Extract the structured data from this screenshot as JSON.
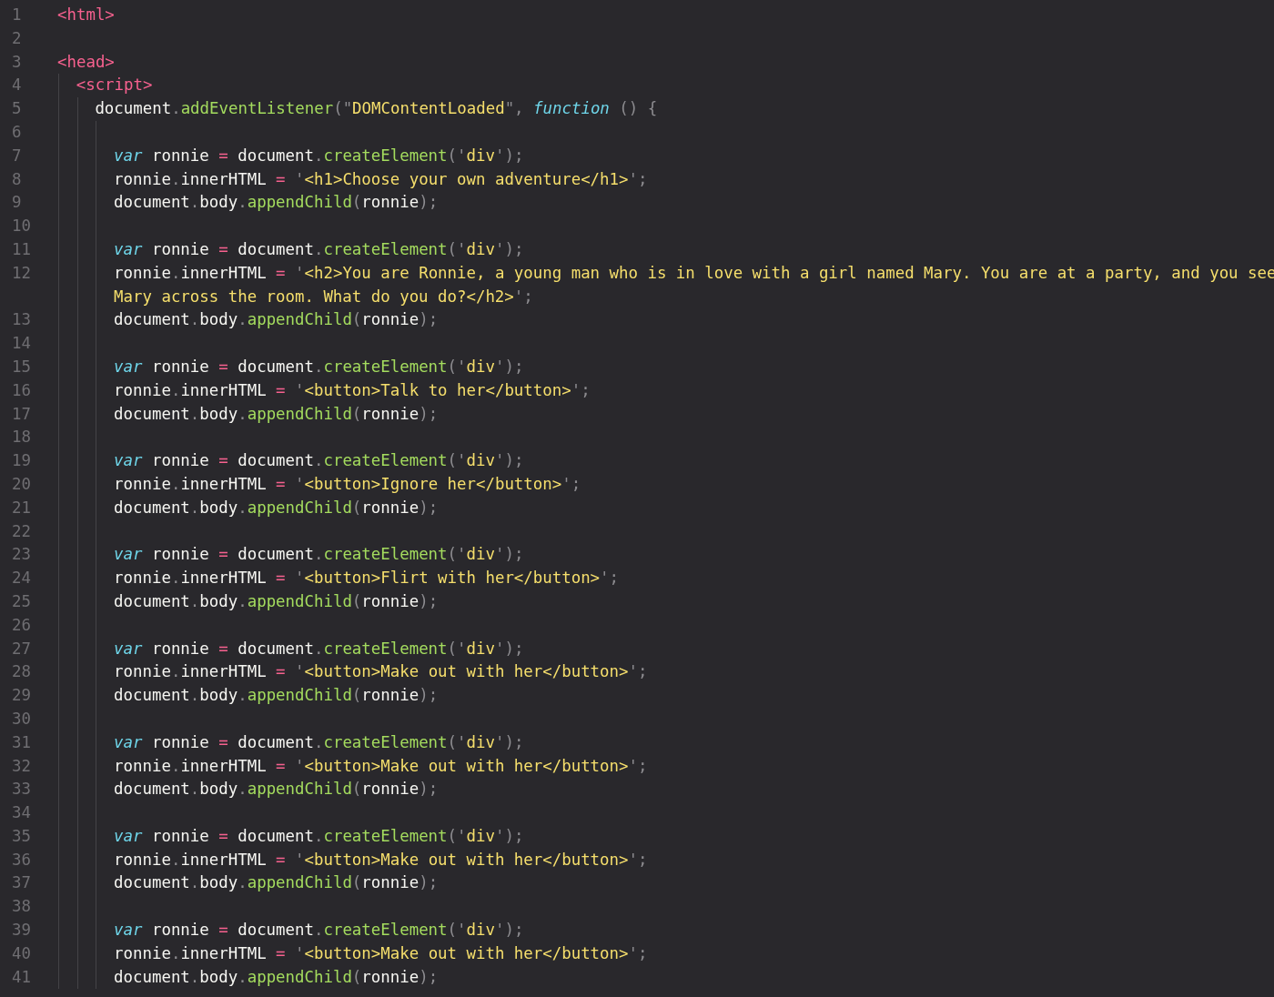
{
  "editor": {
    "lines": [
      {
        "number": "1",
        "tokens": [
          {
            "kind": "tag",
            "text": "<html>"
          }
        ]
      },
      {
        "number": "2"
      },
      {
        "number": "3",
        "tokens": [
          {
            "kind": "tag",
            "text": "<head>"
          }
        ],
        "children": [
          {
            "number": "4",
            "tokens": [
              {
                "kind": "tag",
                "text": "<script>"
              }
            ],
            "children": [
              {
                "number": "5",
                "tokens": [
                  {
                    "kind": "plain",
                    "text": "document"
                  },
                  {
                    "kind": "punct",
                    "text": "."
                  },
                  {
                    "kind": "method",
                    "text": "addEventListener"
                  },
                  {
                    "kind": "punct",
                    "text": "(\""
                  },
                  {
                    "kind": "string",
                    "text": "DOMContentLoaded"
                  },
                  {
                    "kind": "punct",
                    "text": "\", "
                  },
                  {
                    "kind": "keyword",
                    "text": "function"
                  },
                  {
                    "kind": "punct",
                    "text": " () {"
                  }
                ],
                "children": [
                  {
                    "number": "6"
                  },
                  {
                    "number": "7",
                    "tokens": [
                      {
                        "kind": "keyword",
                        "text": "var"
                      },
                      {
                        "kind": "plain",
                        "text": " ronnie "
                      },
                      {
                        "kind": "operator",
                        "text": "="
                      },
                      {
                        "kind": "plain",
                        "text": " document"
                      },
                      {
                        "kind": "punct",
                        "text": "."
                      },
                      {
                        "kind": "method",
                        "text": "createElement"
                      },
                      {
                        "kind": "punct",
                        "text": "('"
                      },
                      {
                        "kind": "string",
                        "text": "div"
                      },
                      {
                        "kind": "punct",
                        "text": "');"
                      }
                    ]
                  },
                  {
                    "number": "8",
                    "tokens": [
                      {
                        "kind": "plain",
                        "text": "ronnie"
                      },
                      {
                        "kind": "punct",
                        "text": "."
                      },
                      {
                        "kind": "plain",
                        "text": "innerHTML "
                      },
                      {
                        "kind": "operator",
                        "text": "="
                      },
                      {
                        "kind": "punct",
                        "text": " '"
                      },
                      {
                        "kind": "string",
                        "text": "<h1>Choose your own adventure</h1>"
                      },
                      {
                        "kind": "punct",
                        "text": "';"
                      }
                    ]
                  },
                  {
                    "number": "9",
                    "tokens": [
                      {
                        "kind": "plain",
                        "text": "document"
                      },
                      {
                        "kind": "punct",
                        "text": "."
                      },
                      {
                        "kind": "plain",
                        "text": "body"
                      },
                      {
                        "kind": "punct",
                        "text": "."
                      },
                      {
                        "kind": "method",
                        "text": "appendChild"
                      },
                      {
                        "kind": "punct",
                        "text": "("
                      },
                      {
                        "kind": "plain",
                        "text": "ronnie"
                      },
                      {
                        "kind": "punct",
                        "text": ");"
                      }
                    ]
                  },
                  {
                    "number": "10"
                  },
                  {
                    "number": "11",
                    "tokens": [
                      {
                        "kind": "keyword",
                        "text": "var"
                      },
                      {
                        "kind": "plain",
                        "text": " ronnie "
                      },
                      {
                        "kind": "operator",
                        "text": "="
                      },
                      {
                        "kind": "plain",
                        "text": " document"
                      },
                      {
                        "kind": "punct",
                        "text": "."
                      },
                      {
                        "kind": "method",
                        "text": "createElement"
                      },
                      {
                        "kind": "punct",
                        "text": "('"
                      },
                      {
                        "kind": "string",
                        "text": "div"
                      },
                      {
                        "kind": "punct",
                        "text": "');"
                      }
                    ]
                  },
                  {
                    "number": "12",
                    "tokens": [
                      {
                        "kind": "plain",
                        "text": "ronnie"
                      },
                      {
                        "kind": "punct",
                        "text": "."
                      },
                      {
                        "kind": "plain",
                        "text": "innerHTML "
                      },
                      {
                        "kind": "operator",
                        "text": "="
                      },
                      {
                        "kind": "punct",
                        "text": " '"
                      },
                      {
                        "kind": "string",
                        "text": "<h2>You are Ronnie, a young man who is in love with a girl named Mary. You are at a party, and you see"
                      }
                    ],
                    "wrap": [
                      {
                        "kind": "string",
                        "text": "Mary across the room. What do you do?</h2>"
                      },
                      {
                        "kind": "punct",
                        "text": "';"
                      }
                    ]
                  },
                  {
                    "number": "13",
                    "tokens": [
                      {
                        "kind": "plain",
                        "text": "document"
                      },
                      {
                        "kind": "punct",
                        "text": "."
                      },
                      {
                        "kind": "plain",
                        "text": "body"
                      },
                      {
                        "kind": "punct",
                        "text": "."
                      },
                      {
                        "kind": "method",
                        "text": "appendChild"
                      },
                      {
                        "kind": "punct",
                        "text": "("
                      },
                      {
                        "kind": "plain",
                        "text": "ronnie"
                      },
                      {
                        "kind": "punct",
                        "text": ");"
                      }
                    ]
                  },
                  {
                    "number": "14"
                  },
                  {
                    "number": "15",
                    "tokens": [
                      {
                        "kind": "keyword",
                        "text": "var"
                      },
                      {
                        "kind": "plain",
                        "text": " ronnie "
                      },
                      {
                        "kind": "operator",
                        "text": "="
                      },
                      {
                        "kind": "plain",
                        "text": " document"
                      },
                      {
                        "kind": "punct",
                        "text": "."
                      },
                      {
                        "kind": "method",
                        "text": "createElement"
                      },
                      {
                        "kind": "punct",
                        "text": "('"
                      },
                      {
                        "kind": "string",
                        "text": "div"
                      },
                      {
                        "kind": "punct",
                        "text": "');"
                      }
                    ]
                  },
                  {
                    "number": "16",
                    "tokens": [
                      {
                        "kind": "plain",
                        "text": "ronnie"
                      },
                      {
                        "kind": "punct",
                        "text": "."
                      },
                      {
                        "kind": "plain",
                        "text": "innerHTML "
                      },
                      {
                        "kind": "operator",
                        "text": "="
                      },
                      {
                        "kind": "punct",
                        "text": " '"
                      },
                      {
                        "kind": "string",
                        "text": "<button>Talk to her</button>"
                      },
                      {
                        "kind": "punct",
                        "text": "';"
                      }
                    ]
                  },
                  {
                    "number": "17",
                    "tokens": [
                      {
                        "kind": "plain",
                        "text": "document"
                      },
                      {
                        "kind": "punct",
                        "text": "."
                      },
                      {
                        "kind": "plain",
                        "text": "body"
                      },
                      {
                        "kind": "punct",
                        "text": "."
                      },
                      {
                        "kind": "method",
                        "text": "appendChild"
                      },
                      {
                        "kind": "punct",
                        "text": "("
                      },
                      {
                        "kind": "plain",
                        "text": "ronnie"
                      },
                      {
                        "kind": "punct",
                        "text": ");"
                      }
                    ]
                  },
                  {
                    "number": "18"
                  },
                  {
                    "number": "19",
                    "tokens": [
                      {
                        "kind": "keyword",
                        "text": "var"
                      },
                      {
                        "kind": "plain",
                        "text": " ronnie "
                      },
                      {
                        "kind": "operator",
                        "text": "="
                      },
                      {
                        "kind": "plain",
                        "text": " document"
                      },
                      {
                        "kind": "punct",
                        "text": "."
                      },
                      {
                        "kind": "method",
                        "text": "createElement"
                      },
                      {
                        "kind": "punct",
                        "text": "('"
                      },
                      {
                        "kind": "string",
                        "text": "div"
                      },
                      {
                        "kind": "punct",
                        "text": "');"
                      }
                    ]
                  },
                  {
                    "number": "20",
                    "tokens": [
                      {
                        "kind": "plain",
                        "text": "ronnie"
                      },
                      {
                        "kind": "punct",
                        "text": "."
                      },
                      {
                        "kind": "plain",
                        "text": "innerHTML "
                      },
                      {
                        "kind": "operator",
                        "text": "="
                      },
                      {
                        "kind": "punct",
                        "text": " '"
                      },
                      {
                        "kind": "string",
                        "text": "<button>Ignore her</button>"
                      },
                      {
                        "kind": "punct",
                        "text": "';"
                      }
                    ]
                  },
                  {
                    "number": "21",
                    "tokens": [
                      {
                        "kind": "plain",
                        "text": "document"
                      },
                      {
                        "kind": "punct",
                        "text": "."
                      },
                      {
                        "kind": "plain",
                        "text": "body"
                      },
                      {
                        "kind": "punct",
                        "text": "."
                      },
                      {
                        "kind": "method",
                        "text": "appendChild"
                      },
                      {
                        "kind": "punct",
                        "text": "("
                      },
                      {
                        "kind": "plain",
                        "text": "ronnie"
                      },
                      {
                        "kind": "punct",
                        "text": ");"
                      }
                    ]
                  },
                  {
                    "number": "22"
                  },
                  {
                    "number": "23",
                    "tokens": [
                      {
                        "kind": "keyword",
                        "text": "var"
                      },
                      {
                        "kind": "plain",
                        "text": " ronnie "
                      },
                      {
                        "kind": "operator",
                        "text": "="
                      },
                      {
                        "kind": "plain",
                        "text": " document"
                      },
                      {
                        "kind": "punct",
                        "text": "."
                      },
                      {
                        "kind": "method",
                        "text": "createElement"
                      },
                      {
                        "kind": "punct",
                        "text": "('"
                      },
                      {
                        "kind": "string",
                        "text": "div"
                      },
                      {
                        "kind": "punct",
                        "text": "');"
                      }
                    ]
                  },
                  {
                    "number": "24",
                    "tokens": [
                      {
                        "kind": "plain",
                        "text": "ronnie"
                      },
                      {
                        "kind": "punct",
                        "text": "."
                      },
                      {
                        "kind": "plain",
                        "text": "innerHTML "
                      },
                      {
                        "kind": "operator",
                        "text": "="
                      },
                      {
                        "kind": "punct",
                        "text": " '"
                      },
                      {
                        "kind": "string",
                        "text": "<button>Flirt with her</button>"
                      },
                      {
                        "kind": "punct",
                        "text": "';"
                      }
                    ]
                  },
                  {
                    "number": "25",
                    "tokens": [
                      {
                        "kind": "plain",
                        "text": "document"
                      },
                      {
                        "kind": "punct",
                        "text": "."
                      },
                      {
                        "kind": "plain",
                        "text": "body"
                      },
                      {
                        "kind": "punct",
                        "text": "."
                      },
                      {
                        "kind": "method",
                        "text": "appendChild"
                      },
                      {
                        "kind": "punct",
                        "text": "("
                      },
                      {
                        "kind": "plain",
                        "text": "ronnie"
                      },
                      {
                        "kind": "punct",
                        "text": ");"
                      }
                    ]
                  },
                  {
                    "number": "26"
                  },
                  {
                    "number": "27",
                    "tokens": [
                      {
                        "kind": "keyword",
                        "text": "var"
                      },
                      {
                        "kind": "plain",
                        "text": " ronnie "
                      },
                      {
                        "kind": "operator",
                        "text": "="
                      },
                      {
                        "kind": "plain",
                        "text": " document"
                      },
                      {
                        "kind": "punct",
                        "text": "."
                      },
                      {
                        "kind": "method",
                        "text": "createElement"
                      },
                      {
                        "kind": "punct",
                        "text": "('"
                      },
                      {
                        "kind": "string",
                        "text": "div"
                      },
                      {
                        "kind": "punct",
                        "text": "');"
                      }
                    ]
                  },
                  {
                    "number": "28",
                    "tokens": [
                      {
                        "kind": "plain",
                        "text": "ronnie"
                      },
                      {
                        "kind": "punct",
                        "text": "."
                      },
                      {
                        "kind": "plain",
                        "text": "innerHTML "
                      },
                      {
                        "kind": "operator",
                        "text": "="
                      },
                      {
                        "kind": "punct",
                        "text": " '"
                      },
                      {
                        "kind": "string",
                        "text": "<button>Make out with her</button>"
                      },
                      {
                        "kind": "punct",
                        "text": "';"
                      }
                    ]
                  },
                  {
                    "number": "29",
                    "tokens": [
                      {
                        "kind": "plain",
                        "text": "document"
                      },
                      {
                        "kind": "punct",
                        "text": "."
                      },
                      {
                        "kind": "plain",
                        "text": "body"
                      },
                      {
                        "kind": "punct",
                        "text": "."
                      },
                      {
                        "kind": "method",
                        "text": "appendChild"
                      },
                      {
                        "kind": "punct",
                        "text": "("
                      },
                      {
                        "kind": "plain",
                        "text": "ronnie"
                      },
                      {
                        "kind": "punct",
                        "text": ");"
                      }
                    ]
                  },
                  {
                    "number": "30"
                  },
                  {
                    "number": "31",
                    "tokens": [
                      {
                        "kind": "keyword",
                        "text": "var"
                      },
                      {
                        "kind": "plain",
                        "text": " ronnie "
                      },
                      {
                        "kind": "operator",
                        "text": "="
                      },
                      {
                        "kind": "plain",
                        "text": " document"
                      },
                      {
                        "kind": "punct",
                        "text": "."
                      },
                      {
                        "kind": "method",
                        "text": "createElement"
                      },
                      {
                        "kind": "punct",
                        "text": "('"
                      },
                      {
                        "kind": "string",
                        "text": "div"
                      },
                      {
                        "kind": "punct",
                        "text": "');"
                      }
                    ]
                  },
                  {
                    "number": "32",
                    "tokens": [
                      {
                        "kind": "plain",
                        "text": "ronnie"
                      },
                      {
                        "kind": "punct",
                        "text": "."
                      },
                      {
                        "kind": "plain",
                        "text": "innerHTML "
                      },
                      {
                        "kind": "operator",
                        "text": "="
                      },
                      {
                        "kind": "punct",
                        "text": " '"
                      },
                      {
                        "kind": "string",
                        "text": "<button>Make out with her</button>"
                      },
                      {
                        "kind": "punct",
                        "text": "';"
                      }
                    ]
                  },
                  {
                    "number": "33",
                    "tokens": [
                      {
                        "kind": "plain",
                        "text": "document"
                      },
                      {
                        "kind": "punct",
                        "text": "."
                      },
                      {
                        "kind": "plain",
                        "text": "body"
                      },
                      {
                        "kind": "punct",
                        "text": "."
                      },
                      {
                        "kind": "method",
                        "text": "appendChild"
                      },
                      {
                        "kind": "punct",
                        "text": "("
                      },
                      {
                        "kind": "plain",
                        "text": "ronnie"
                      },
                      {
                        "kind": "punct",
                        "text": ");"
                      }
                    ]
                  },
                  {
                    "number": "34"
                  },
                  {
                    "number": "35",
                    "tokens": [
                      {
                        "kind": "keyword",
                        "text": "var"
                      },
                      {
                        "kind": "plain",
                        "text": " ronnie "
                      },
                      {
                        "kind": "operator",
                        "text": "="
                      },
                      {
                        "kind": "plain",
                        "text": " document"
                      },
                      {
                        "kind": "punct",
                        "text": "."
                      },
                      {
                        "kind": "method",
                        "text": "createElement"
                      },
                      {
                        "kind": "punct",
                        "text": "('"
                      },
                      {
                        "kind": "string",
                        "text": "div"
                      },
                      {
                        "kind": "punct",
                        "text": "');"
                      }
                    ]
                  },
                  {
                    "number": "36",
                    "tokens": [
                      {
                        "kind": "plain",
                        "text": "ronnie"
                      },
                      {
                        "kind": "punct",
                        "text": "."
                      },
                      {
                        "kind": "plain",
                        "text": "innerHTML "
                      },
                      {
                        "kind": "operator",
                        "text": "="
                      },
                      {
                        "kind": "punct",
                        "text": " '"
                      },
                      {
                        "kind": "string",
                        "text": "<button>Make out with her</button>"
                      },
                      {
                        "kind": "punct",
                        "text": "';"
                      }
                    ]
                  },
                  {
                    "number": "37",
                    "tokens": [
                      {
                        "kind": "plain",
                        "text": "document"
                      },
                      {
                        "kind": "punct",
                        "text": "."
                      },
                      {
                        "kind": "plain",
                        "text": "body"
                      },
                      {
                        "kind": "punct",
                        "text": "."
                      },
                      {
                        "kind": "method",
                        "text": "appendChild"
                      },
                      {
                        "kind": "punct",
                        "text": "("
                      },
                      {
                        "kind": "plain",
                        "text": "ronnie"
                      },
                      {
                        "kind": "punct",
                        "text": ");"
                      }
                    ]
                  },
                  {
                    "number": "38"
                  },
                  {
                    "number": "39",
                    "tokens": [
                      {
                        "kind": "keyword",
                        "text": "var"
                      },
                      {
                        "kind": "plain",
                        "text": " ronnie "
                      },
                      {
                        "kind": "operator",
                        "text": "="
                      },
                      {
                        "kind": "plain",
                        "text": " document"
                      },
                      {
                        "kind": "punct",
                        "text": "."
                      },
                      {
                        "kind": "method",
                        "text": "createElement"
                      },
                      {
                        "kind": "punct",
                        "text": "('"
                      },
                      {
                        "kind": "string",
                        "text": "div"
                      },
                      {
                        "kind": "punct",
                        "text": "');"
                      }
                    ]
                  },
                  {
                    "number": "40",
                    "tokens": [
                      {
                        "kind": "plain",
                        "text": "ronnie"
                      },
                      {
                        "kind": "punct",
                        "text": "."
                      },
                      {
                        "kind": "plain",
                        "text": "innerHTML "
                      },
                      {
                        "kind": "operator",
                        "text": "="
                      },
                      {
                        "kind": "punct",
                        "text": " '"
                      },
                      {
                        "kind": "string",
                        "text": "<button>Make out with her</button>"
                      },
                      {
                        "kind": "punct",
                        "text": "';"
                      }
                    ]
                  },
                  {
                    "number": "41",
                    "tokens": [
                      {
                        "kind": "plain",
                        "text": "document"
                      },
                      {
                        "kind": "punct",
                        "text": "."
                      },
                      {
                        "kind": "plain",
                        "text": "body"
                      },
                      {
                        "kind": "punct",
                        "text": "."
                      },
                      {
                        "kind": "method",
                        "text": "appendChild"
                      },
                      {
                        "kind": "punct",
                        "text": "("
                      },
                      {
                        "kind": "plain",
                        "text": "ronnie"
                      },
                      {
                        "kind": "punct",
                        "text": ");"
                      }
                    ]
                  }
                ]
              }
            ]
          }
        ]
      }
    ]
  }
}
